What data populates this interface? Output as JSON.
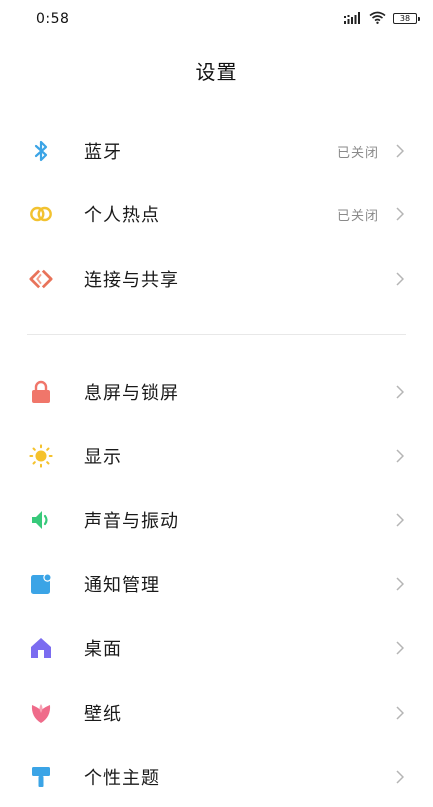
{
  "status_bar": {
    "time": "0:58",
    "battery_level": "38"
  },
  "header": {
    "title": "设置"
  },
  "sections": [
    {
      "items": [
        {
          "label": "蓝牙",
          "value": "已关闭",
          "icon": "bluetooth-icon",
          "color": "#3ba4e6"
        },
        {
          "label": "个人热点",
          "value": "已关闭",
          "icon": "hotspot-icon",
          "color": "#f2c230"
        },
        {
          "label": "连接与共享",
          "value": "",
          "icon": "connection-share-icon",
          "color": "#e8735a"
        }
      ]
    },
    {
      "items": [
        {
          "label": "息屏与锁屏",
          "icon": "lock-icon",
          "color": "#f0766a"
        },
        {
          "label": "显示",
          "icon": "sun-icon",
          "color": "#f5c22c"
        },
        {
          "label": "声音与振动",
          "icon": "speaker-icon",
          "color": "#37c97a"
        },
        {
          "label": "通知管理",
          "icon": "notification-icon",
          "color": "#3ba4e6"
        },
        {
          "label": "桌面",
          "icon": "home-icon",
          "color": "#7b6cf0"
        },
        {
          "label": "壁纸",
          "icon": "tulip-icon",
          "color": "#ef6b8a"
        },
        {
          "label": "个性主题",
          "icon": "brush-icon",
          "color": "#3ba4e6"
        }
      ]
    }
  ]
}
